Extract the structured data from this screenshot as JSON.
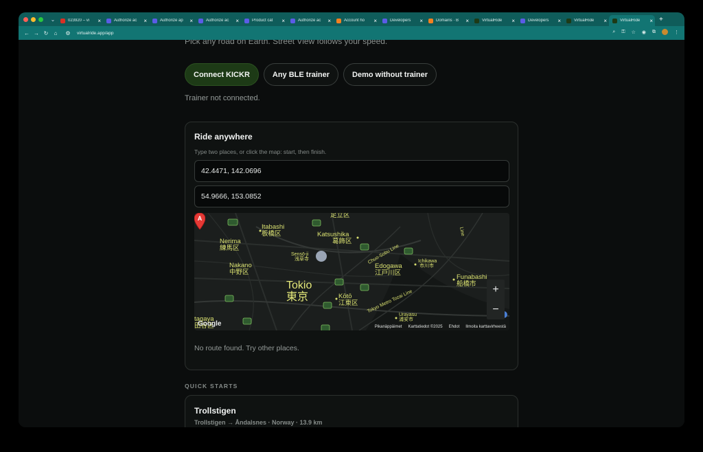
{
  "browser": {
    "tabs": [
      {
        "title": "023920 – vi",
        "color": "#d93025"
      },
      {
        "title": "Authorize ac",
        "color": "#5b5ce6"
      },
      {
        "title": "Authorize ap",
        "color": "#5b5ce6"
      },
      {
        "title": "Authorize ac",
        "color": "#5b5ce6"
      },
      {
        "title": "Product cat",
        "color": "#5b5ce6"
      },
      {
        "title": "Authorize ac",
        "color": "#5b5ce6"
      },
      {
        "title": "Account ho",
        "color": "#f38020"
      },
      {
        "title": "Developers",
        "color": "#5b5ce6"
      },
      {
        "title": "Domains · B",
        "color": "#f38020"
      },
      {
        "title": "VirtualRide",
        "color": "#1d3a16"
      },
      {
        "title": "Developers",
        "color": "#5b5ce6"
      },
      {
        "title": "VirtualRide",
        "color": "#1d3a16"
      },
      {
        "title": "VirtualRide",
        "color": "#1d3a16"
      }
    ],
    "active_tab_index": 12,
    "url": "virtualride.app/app"
  },
  "page": {
    "intro_text": "Pick any road on Earth. Street View follows your speed.",
    "buttons": {
      "connect_kickr": "Connect KICKR",
      "any_ble": "Any BLE trainer",
      "demo": "Demo without trainer"
    },
    "trainer_status": "Trainer not connected.",
    "ride_card": {
      "title": "Ride anywhere",
      "hint": "Type two places, or click the map: start, then finish.",
      "start_value": "42.4471, 142.0696",
      "finish_value": "54.9666, 153.0852",
      "no_route": "No route found. Try other places."
    },
    "map": {
      "labels": {
        "adachi": "足立区",
        "itabashi": "Itabashi",
        "itabashi_jp": "板橋区",
        "katsushika": "Katsushika",
        "katsushika_jp": "葛飾区",
        "nerima": "Nerima",
        "nerima_jp": "練馬区",
        "sensoji": "Sensō-ji",
        "sensoji_jp": "浅草寺",
        "chuo_sobu": "Chuo-Sobu Line",
        "ichikawa": "Ichikawa",
        "ichikawa_jp": "市川市",
        "nakano": "Nakano",
        "nakano_jp": "中野区",
        "edogawa": "Edogawa",
        "edogawa_jp": "江戸川区",
        "funabashi": "Funabashi",
        "funabashi_jp": "船橋市",
        "tokio": "Tokio",
        "tokio_jp": "東京",
        "koto": "Kōtō",
        "koto_jp": "江東区",
        "tozai": "Tokyo Metro Tozai Line",
        "urayasu": "Urayasu",
        "urayasu_jp": "浦安市",
        "line": "Line",
        "setagaya": "tagaya",
        "setagaya_jp": "田谷区"
      },
      "marker_label": "A",
      "zoom_in": "+",
      "zoom_out": "−",
      "google": "Google",
      "attribution": {
        "shortcuts": "Pikanäppäimet",
        "map_data": "Karttatiedot ©2025",
        "terms": "Ehdot",
        "report": "Ilmoita karttavirheestä"
      }
    },
    "quick_starts_heading": "QUICK STARTS",
    "quick_start": {
      "title": "Trollstigen",
      "subtitle": "Trollstigen → Åndalsnes · Norway · 13.9 km"
    }
  }
}
